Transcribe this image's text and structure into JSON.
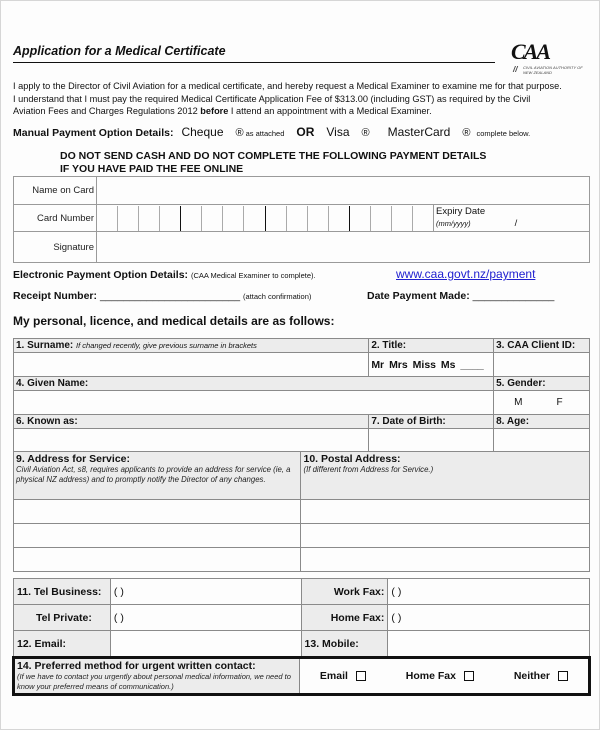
{
  "document": {
    "title": "Application for a Medical Certificate",
    "logo": {
      "mark": "CAA",
      "subtitle": "Civil Aviation Authority of New Zealand"
    },
    "intro": {
      "line1": "I apply to the Director of Civil Aviation for a medical certificate, and hereby request a Medical Examiner to examine me for that purpose.",
      "line2": "I understand that I must pay the required Medical Certificate Application Fee of $313.00 (including GST) as required by the Civil",
      "line3_a": "Aviation Fees and Charges Regulations 2012 ",
      "line3_bold": "before",
      "line3_b": " I attend an appointment with a Medical Examiner."
    },
    "manual_payment": {
      "label": "Manual Payment Option Details:",
      "cheque": "Cheque",
      "reg_symbol": "®",
      "as_attached": "as attached",
      "or": "OR",
      "visa": "Visa",
      "mastercard": "MasterCard",
      "complete_below": "complete below."
    },
    "warning": {
      "line1": "DO NOT SEND CASH AND DO NOT COMPLETE THE FOLLOWING PAYMENT DETAILS",
      "line2": "IF YOU HAVE PAID THE FEE ONLINE"
    },
    "card": {
      "name_label": "Name on Card",
      "number_label": "Card Number",
      "signature_label": "Signature",
      "expiry_label": "Expiry Date",
      "expiry_format": "(mm/yyyy)",
      "expiry_sep": "/"
    },
    "electronic_payment": {
      "label": "Electronic Payment Option Details:",
      "note": "(CAA Medical Examiner to complete).",
      "link": "www.caa.govt.nz/payment",
      "receipt_label": "Receipt Number:",
      "receipt_blank": "________________________",
      "attach": "(attach confirmation)",
      "date_label": "Date Payment Made:",
      "date_blank": "______________"
    },
    "personal_heading": "My personal, licence, and medical details are as follows:",
    "personal": {
      "surname_label": "1. Surname:",
      "surname_hint": "If changed recently, give previous surname in brackets",
      "title_label": "2. Title:",
      "title_options": "Mr  Mrs  Miss  Ms  ____",
      "client_id_label": "3. CAA Client ID:",
      "given_name_label": "4. Given Name:",
      "gender_label": "5. Gender:",
      "gender_m": "M",
      "gender_f": "F",
      "known_as_label": "6. Known as:",
      "dob_label": "7. Date of Birth:",
      "age_label": "8. Age:"
    },
    "address": {
      "service_label": "9. Address for Service:",
      "service_hint": "Civil Aviation Act, s8, requires applicants to provide an address for service (ie, a physical NZ address) and to promptly notify the Director of any changes.",
      "postal_label": "10. Postal Address:",
      "postal_hint": "(If different from Address for Service.)"
    },
    "contact": {
      "tel_business": "11.  Tel Business:",
      "tel_private": "Tel Private:",
      "work_fax": "Work Fax:",
      "home_fax": "Home Fax:",
      "email": "12.  Email:",
      "mobile": "13. Mobile:",
      "paren": "(          )"
    },
    "preferred": {
      "label": "14. Preferred method for urgent written contact:",
      "hint": "(If we have to contact you urgently about personal medical information, we need to know your preferred means of communication.)",
      "options": [
        "Email",
        "Home Fax",
        "Neither"
      ]
    }
  }
}
